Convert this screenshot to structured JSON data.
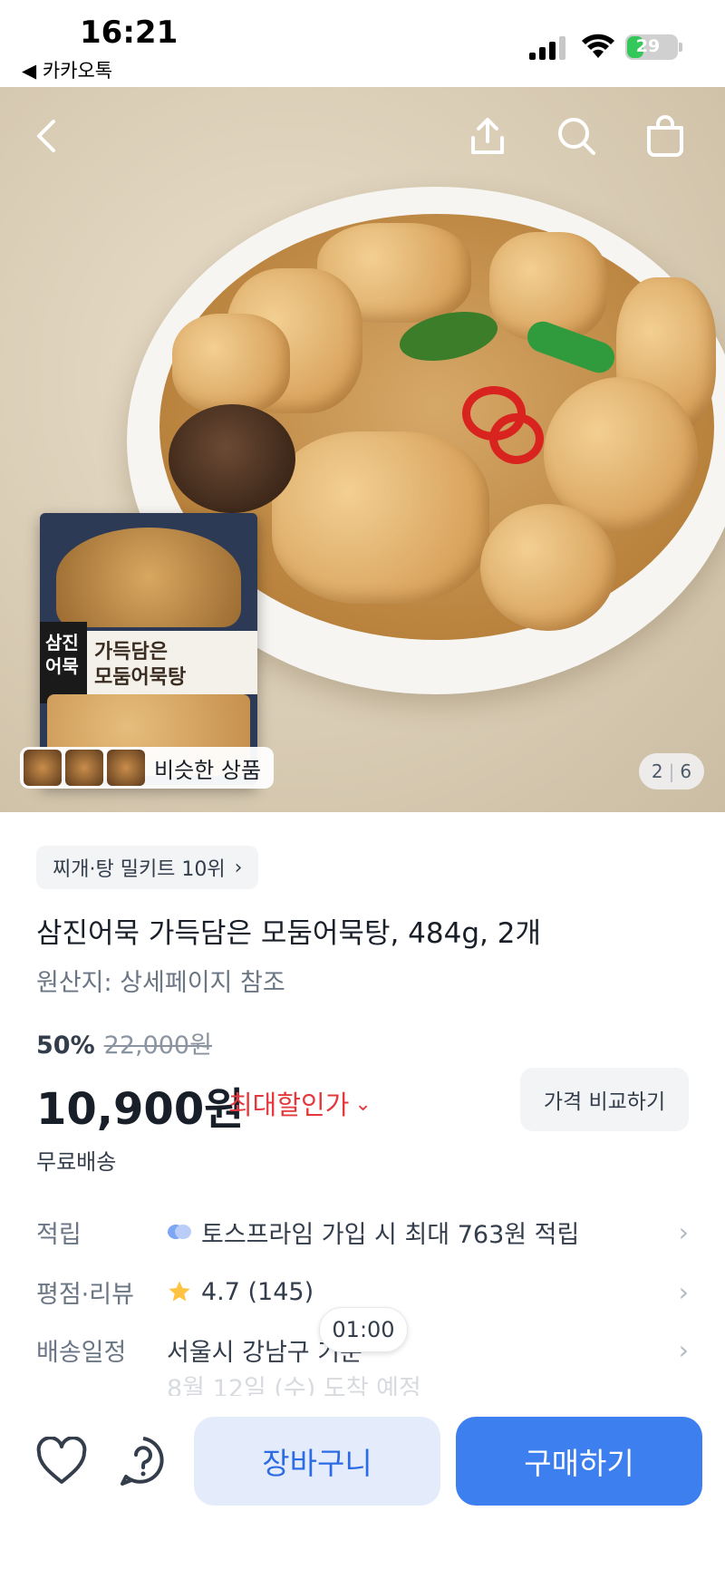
{
  "status_bar": {
    "time": "16:21",
    "back_app": "◀ 카카오톡",
    "battery": "29",
    "icons": [
      "signal-icon",
      "wifi-icon",
      "battery-icon"
    ]
  },
  "hero": {
    "nav_icons": [
      "back-icon",
      "share-icon",
      "search-icon",
      "shopping-bag-icon"
    ],
    "similar_label": "비슷한 상품",
    "page_current": "2",
    "page_total": "6",
    "pack_brand": "삼진어묵",
    "pack_name_line1": "가득담은",
    "pack_name_line2": "모둠어묵탕"
  },
  "product": {
    "rank_chip": "찌개·탕 밀키트 10위",
    "title": "삼진어묵 가득담은 모둠어묵탕, 484g, 2개",
    "origin": "원산지: 상세페이지 참조",
    "discount_pct": "50%",
    "original_price": "22,000원",
    "price": "10,900원",
    "max_discount_label": "최대할인가",
    "compare_button": "가격 비교하기",
    "shipping": "무료배송"
  },
  "info_rows": {
    "reward_key": "적립",
    "reward_value": "토스프라임 가입 시 최대 763원 적립",
    "rating_key": "평점·리뷰",
    "rating_value": "4.7 (145)",
    "delivery_key": "배송일정",
    "delivery_value": "서울시 강남구 기준",
    "delivery_date": "8월 12일 (수) 도착 예정"
  },
  "toast": "01:00",
  "bottom_bar": {
    "cart_label": "장바구니",
    "buy_label": "구매하기"
  },
  "colors": {
    "accent": "#3e7ff0",
    "accent_light": "#e4ecfb",
    "discount_red": "#e4383d",
    "star": "#ffc342"
  }
}
